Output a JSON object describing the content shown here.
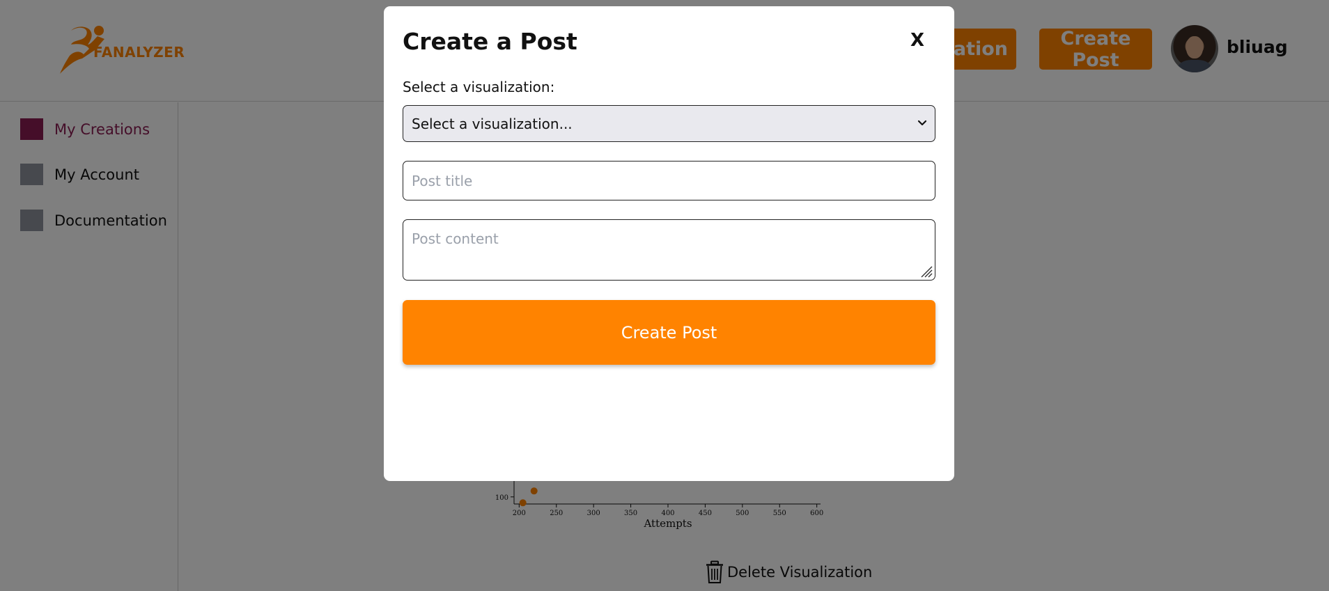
{
  "brand": {
    "logo_text": "FANALYZER",
    "accent_color": "#ff8300",
    "active_color": "#8a1d52"
  },
  "header": {
    "create_visualization_label": "Create Visualization",
    "create_visualization_visible": "ization",
    "create_post_label": "Create Post",
    "username": "bliuag"
  },
  "sidebar": {
    "items": [
      {
        "label": "My Creations",
        "active": true
      },
      {
        "label": "My Account",
        "active": false
      },
      {
        "label": "Documentation",
        "active": false
      }
    ]
  },
  "chart_data": {
    "type": "scatter",
    "xlabel": "Attempts",
    "x_ticks": [
      "200",
      "250",
      "300",
      "350",
      "400",
      "450",
      "500",
      "550",
      "600"
    ],
    "y_ticks": [
      "100"
    ],
    "xlim": [
      195,
      605
    ],
    "points": [
      {
        "x": 220,
        "y": 110
      },
      {
        "x": 205,
        "y": 90
      }
    ]
  },
  "delete_visualization_label": "Delete Visualization",
  "modal": {
    "title": "Create a Post",
    "close_label": "X",
    "select_label": "Select a visualization:",
    "select_value": "Select a visualization...",
    "title_placeholder": "Post title",
    "content_placeholder": "Post content",
    "submit_label": "Create Post"
  }
}
